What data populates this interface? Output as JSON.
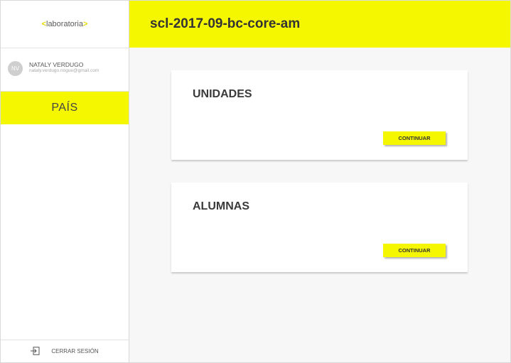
{
  "colors": {
    "accent": "#f5f700"
  },
  "sidebar": {
    "logo": {
      "text": "laboratoria"
    },
    "user": {
      "initials": "NV",
      "name": "NATALY VERDUGO",
      "email": "nataly.verdugo.nogue@gmail.com"
    },
    "nav_items": [
      {
        "label": "PAÍS"
      }
    ],
    "logout": {
      "label": "CERRAR SESIÓN",
      "icon": "logout-icon"
    }
  },
  "header": {
    "title": "scl-2017-09-bc-core-am"
  },
  "cards": [
    {
      "title": "UNIDADES",
      "button_label": "CONTINUAR"
    },
    {
      "title": "ALUMNAS",
      "button_label": "CONTINUAR"
    }
  ]
}
